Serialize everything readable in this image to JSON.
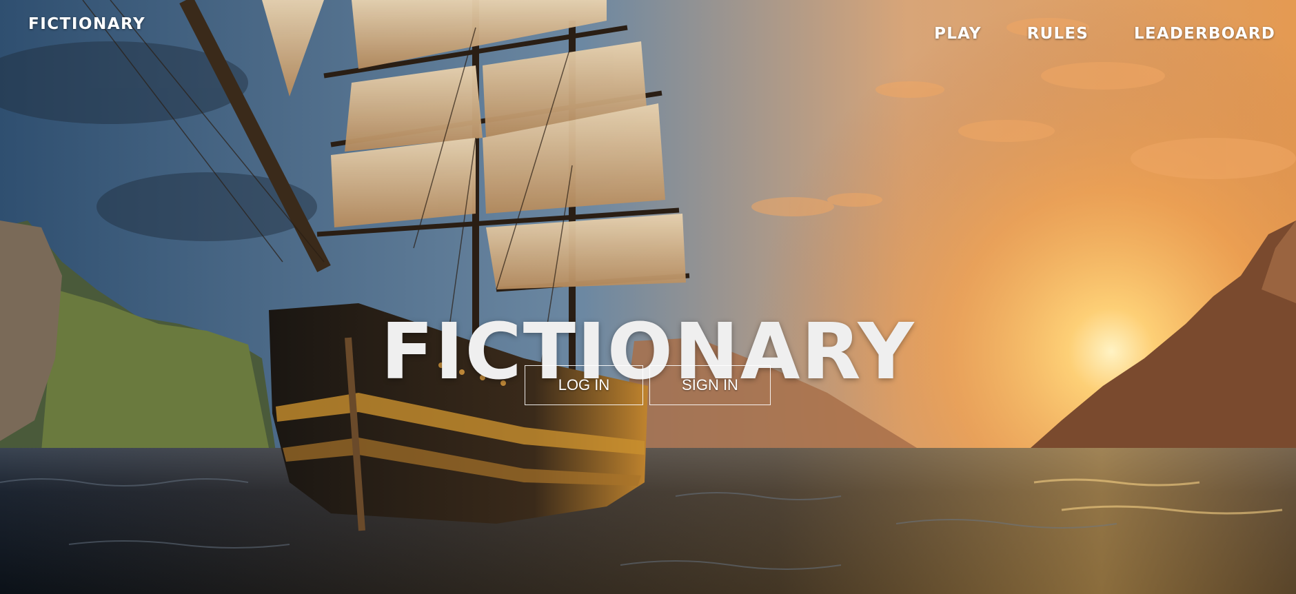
{
  "header": {
    "brand": "FICTIONARY",
    "nav": {
      "play": "PLAY",
      "rules": "RULES",
      "leaderboard": "LEADERBOARD"
    }
  },
  "hero": {
    "title": "FICTIONARY",
    "login_label": "LOG IN",
    "signin_label": "SIGN IN",
    "background": "tall-ship-sailing-at-sunset"
  },
  "colors": {
    "text": "#ffffff",
    "title": "#efefef",
    "sky": "#3b5a78",
    "sunset": "#e8a248",
    "sea": "#141c26"
  }
}
